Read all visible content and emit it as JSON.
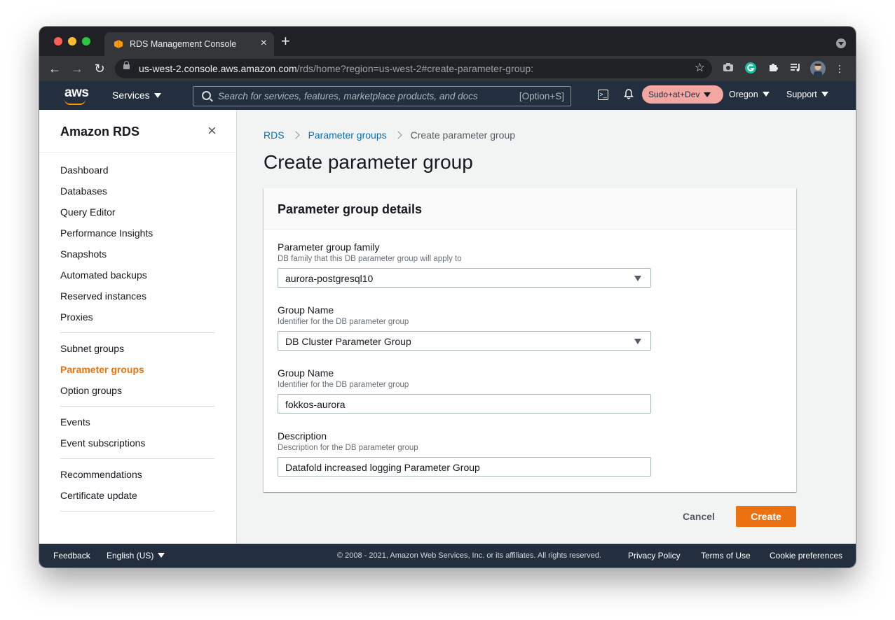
{
  "browser": {
    "tab_title": "RDS Management Console",
    "tab_close": "×",
    "new_tab": "+",
    "url_host": "us-west-2.console.aws.amazon.com",
    "url_path": "/rds/home?region=us-west-2#create-parameter-group:"
  },
  "aws_header": {
    "logo": "aws",
    "services": "Services",
    "search_placeholder": "Search for services, features, marketplace products, and docs",
    "search_shortcut": "[Option+S]",
    "account": "Sudo+at+Dev",
    "region": "Oregon",
    "support": "Support"
  },
  "sidebar": {
    "title": "Amazon RDS",
    "close": "×",
    "groups": [
      [
        "Dashboard",
        "Databases",
        "Query Editor",
        "Performance Insights",
        "Snapshots",
        "Automated backups",
        "Reserved instances",
        "Proxies"
      ],
      [
        "Subnet groups",
        "Parameter groups",
        "Option groups"
      ],
      [
        "Events",
        "Event subscriptions"
      ],
      [
        "Recommendations",
        "Certificate update"
      ]
    ],
    "active_item": "Parameter groups"
  },
  "breadcrumb": {
    "items": [
      "RDS",
      "Parameter groups",
      "Create parameter group"
    ]
  },
  "page": {
    "title": "Create parameter group"
  },
  "panel": {
    "title": "Parameter group details",
    "fields": [
      {
        "label": "Parameter group family",
        "description": "DB family that this DB parameter group will apply to",
        "value": "aurora-postgresql10",
        "type": "select"
      },
      {
        "label": "Group Name",
        "description": "Identifier for the DB parameter group",
        "value": "DB Cluster Parameter Group",
        "type": "select"
      },
      {
        "label": "Group Name",
        "description": "Identifier for the DB parameter group",
        "value": "fokkos-aurora",
        "type": "input"
      },
      {
        "label": "Description",
        "description": "Description for the DB parameter group",
        "value": "Datafold increased logging Parameter Group",
        "type": "input"
      }
    ]
  },
  "actions": {
    "cancel": "Cancel",
    "create": "Create"
  },
  "footer": {
    "feedback": "Feedback",
    "language": "English (US)",
    "copyright": "© 2008 - 2021, Amazon Web Services, Inc. or its affiliates. All rights reserved.",
    "privacy": "Privacy Policy",
    "terms": "Terms of Use",
    "cookies": "Cookie preferences"
  },
  "colors": {
    "aws_nav": "#232f3e",
    "accent_orange": "#ec7211",
    "link_blue": "#0073bb",
    "account_badge": "#f4a6a0"
  }
}
